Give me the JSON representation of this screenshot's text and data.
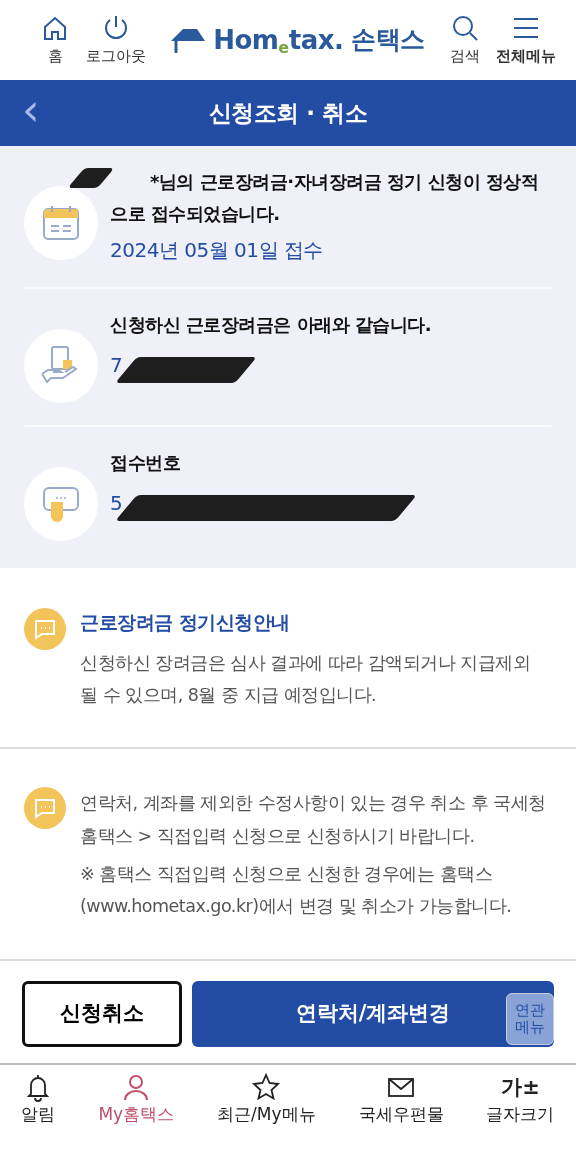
{
  "header": {
    "left_buttons": [
      {
        "kind": "home",
        "label": "홈"
      },
      {
        "kind": "power",
        "label": "로그아웃"
      }
    ],
    "logo": {
      "brand": "Hom$_{e}$tax.",
      "name": "손택스"
    },
    "right_buttons": [
      {
        "kind": "search",
        "label": "검색"
      },
      {
        "kind": "menu",
        "label": "전체메뉴"
      }
    ]
  },
  "title_bar": {
    "back": "‹",
    "title": "신청조회 · 취소"
  },
  "summary": [
    {
      "kind": "calendar",
      "title": "*님의 근로장려금·자녀장려금 정기 신청이 정상적으로 접수되었습니다.",
      "value": "2024년 05월 01일 접수",
      "redacted": true
    },
    {
      "kind": "money",
      "title": "신청하신 근로장려금은 아래와 같습니다.",
      "value": "7",
      "redacted": true
    },
    {
      "kind": "chat",
      "title": "접수번호",
      "value": "5",
      "redacted": true
    }
  ],
  "notices": [
    {
      "heading": "근로장려금 정기신청안내",
      "paragraphs": [
        "신청하신 장려금은 심사 결과에 따라 감액되거나 지급제외 될 수 있으며, 8월 중 지급 예정입니다."
      ]
    },
    {
      "paragraphs": [
        "연락처, 계좌를 제외한 수정사항이 있는 경우 취소 후 국세청 홈택스 > 직접입력 신청으로 신청하시기 바랍니다.",
        "※ 홈택스 직접입력 신청으로 신청한 경우에는 홈택스(www.hometax.go.kr)에서 변경 및 취소가 가능합니다."
      ]
    }
  ],
  "actions": [
    {
      "kind": "outline",
      "label": "신청취소"
    },
    {
      "kind": "primary",
      "label": "연락처/계좌변경"
    }
  ],
  "floating_button": "연관\n메뉴",
  "bottom_nav": [
    {
      "kind": "bell",
      "label": "알림",
      "selected": false
    },
    {
      "kind": "person",
      "label": "My홈택스",
      "selected": true
    },
    {
      "kind": "star",
      "label": "최근/My메뉴",
      "selected": false
    },
    {
      "kind": "mail",
      "label": "국세우편물",
      "selected": false
    },
    {
      "kind": "font",
      "label": "글자크기",
      "glyph": "가±",
      "selected": false
    }
  ]
}
